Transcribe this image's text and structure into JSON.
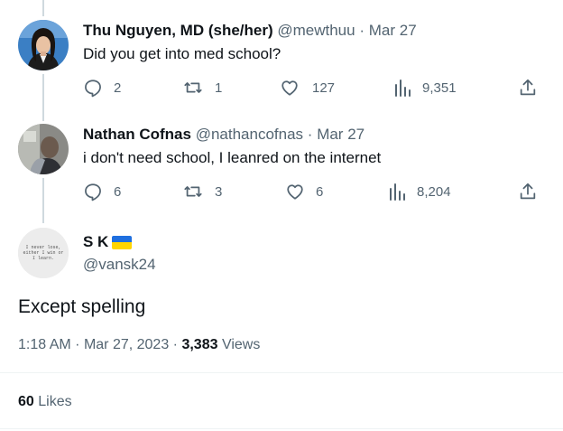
{
  "colors": {
    "text": "#0f1419",
    "muted": "#536471",
    "divider": "#eff3f4",
    "thread_line": "#cfd9de",
    "flag_blue": "#1f6fdf",
    "flag_yellow": "#ffd500"
  },
  "tweets": [
    {
      "name": "Thu Nguyen, MD (she/her)",
      "handle": "@mewthuu",
      "sep": "·",
      "date": "Mar 27",
      "text": "Did you get into med school?",
      "replies": "2",
      "retweets": "1",
      "likes": "127",
      "views": "9,351"
    },
    {
      "name": "Nathan Cofnas",
      "handle": "@nathancofnas",
      "sep": "·",
      "date": "Mar 27",
      "text": "i don't need school, I leanred on the internet",
      "replies": "6",
      "retweets": "3",
      "likes": "6",
      "views": "8,204"
    }
  ],
  "main_tweet": {
    "name": "S K",
    "handle": "@vansk24",
    "avatar_text": [
      "I never lose,",
      "either I win or",
      "I learn."
    ],
    "text": "Except spelling",
    "time": "1:18 AM",
    "dot": "·",
    "date": "Mar 27, 2023",
    "views_count": "3,383",
    "views_label": "Views",
    "likes_count": "60",
    "likes_label": "Likes"
  },
  "icons": [
    "reply-icon",
    "retweet-icon",
    "like-icon",
    "views-icon",
    "share-icon",
    "ukraine-flag-icon"
  ]
}
